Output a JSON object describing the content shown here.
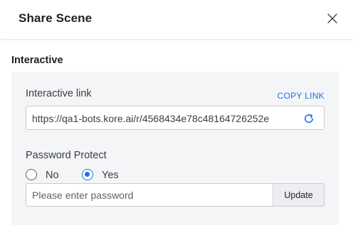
{
  "dialog": {
    "title": "Share Scene",
    "close_icon": "close-icon"
  },
  "interactive": {
    "section_title": "Interactive",
    "link_label": "Interactive link",
    "copy_link_label": "COPY LINK",
    "link_value": "https://qa1-bots.kore.ai/r/4568434e78c48164726252e",
    "refresh_icon": "refresh-icon",
    "password_label": "Password Protect",
    "options": [
      {
        "label": "No",
        "selected": false
      },
      {
        "label": "Yes",
        "selected": true
      }
    ],
    "password_placeholder": "Please enter password",
    "update_label": "Update"
  },
  "colors": {
    "accent": "#1a73e8",
    "panel_bg": "#f4f5f7",
    "border": "#c9ccd1"
  }
}
